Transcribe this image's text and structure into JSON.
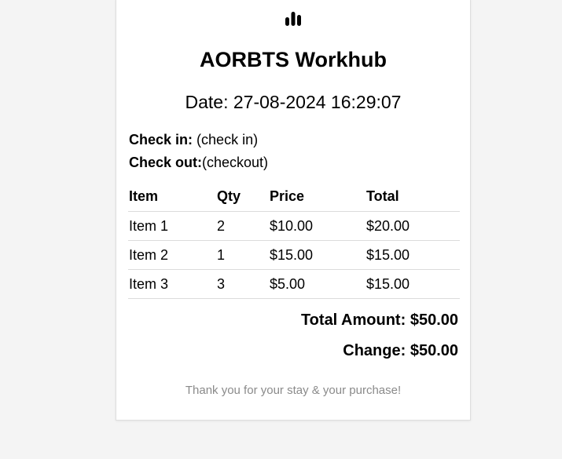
{
  "receipt": {
    "logo_icon": "bar-chart-icon",
    "title": "AORBTS Workhub",
    "date_label": "Date:",
    "date_value": "27-08-2024 16:29:07",
    "check_in_label": "Check in:",
    "check_in_value": "(check in)",
    "check_out_label": "Check out:",
    "check_out_value": "(checkout)",
    "table": {
      "headers": [
        "Item",
        "Qty",
        "Price",
        "Total"
      ],
      "rows": [
        [
          "Item 1",
          "2",
          "$10.00",
          "$20.00"
        ],
        [
          "Item 2",
          "1",
          "$15.00",
          "$15.00"
        ],
        [
          "Item 3",
          "3",
          "$5.00",
          "$15.00"
        ]
      ]
    },
    "total_label": "Total Amount:",
    "total_value": "$50.00",
    "change_label": "Change:",
    "change_value": "$50.00",
    "footer": "Thank you for your stay & your purchase!"
  },
  "colors": {
    "page_background": "#f4f4f4",
    "card_background": "#ffffff",
    "footer_text": "#8a8a8a",
    "divider": "#dcdcdc"
  }
}
